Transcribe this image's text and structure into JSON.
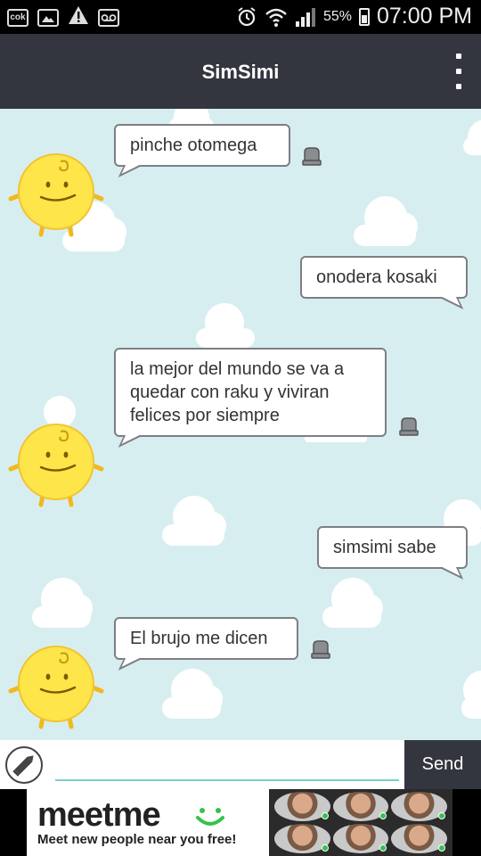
{
  "status_bar": {
    "left_icons": [
      "cok-icon",
      "image-icon",
      "warning-icon",
      "voicemail-icon"
    ],
    "cok_label": "cok",
    "battery_percent": "55%",
    "time": "07:00 PM"
  },
  "app_bar": {
    "title": "SimSimi"
  },
  "messages": [
    {
      "from": "simsimi",
      "text": "pinche otomega"
    },
    {
      "from": "user",
      "text": "onodera kosaki"
    },
    {
      "from": "simsimi",
      "text": "la mejor del mundo se va a quedar con raku y viviran felices por siempre"
    },
    {
      "from": "user",
      "text": "simsimi sabe"
    },
    {
      "from": "simsimi",
      "text": "El brujo me dicen"
    }
  ],
  "input_bar": {
    "placeholder": "",
    "value": "",
    "send_label": "Send"
  },
  "ad": {
    "brand": "meetme",
    "tagline": "Meet new people near you free!"
  },
  "colors": {
    "app_bar": "#33363f",
    "chat_background": "#d7eef1",
    "bubble_border": "#7d7f84",
    "avatar_yellow": "#fde54a",
    "input_underline": "#7ccdcd"
  }
}
